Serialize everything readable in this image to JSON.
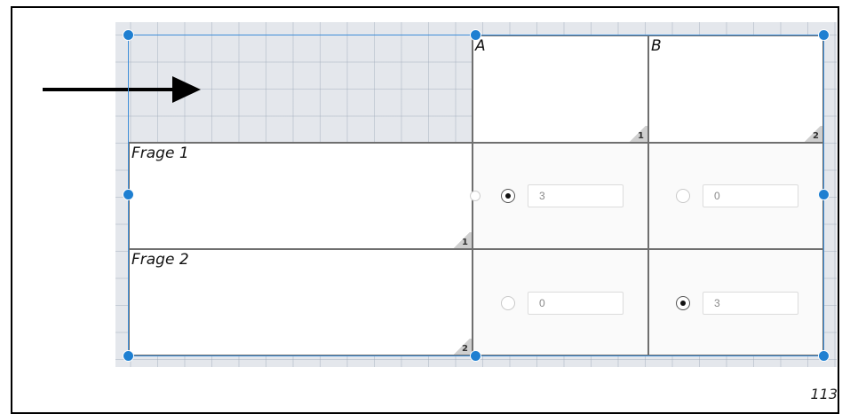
{
  "columns": [
    {
      "title": "A",
      "index": "1"
    },
    {
      "title": "B",
      "index": "2"
    }
  ],
  "rows": [
    {
      "title": "Frage 1",
      "index": "1",
      "cells": [
        {
          "checked": true,
          "score": "3"
        },
        {
          "checked": false,
          "score": "0"
        }
      ]
    },
    {
      "title": "Frage 2",
      "index": "2",
      "cells": [
        {
          "checked": false,
          "score": "0"
        },
        {
          "checked": true,
          "score": "3"
        }
      ]
    }
  ],
  "page_number": "113",
  "colors": {
    "selection": "#1e7fd1",
    "canvas": "#e4e7ec"
  }
}
